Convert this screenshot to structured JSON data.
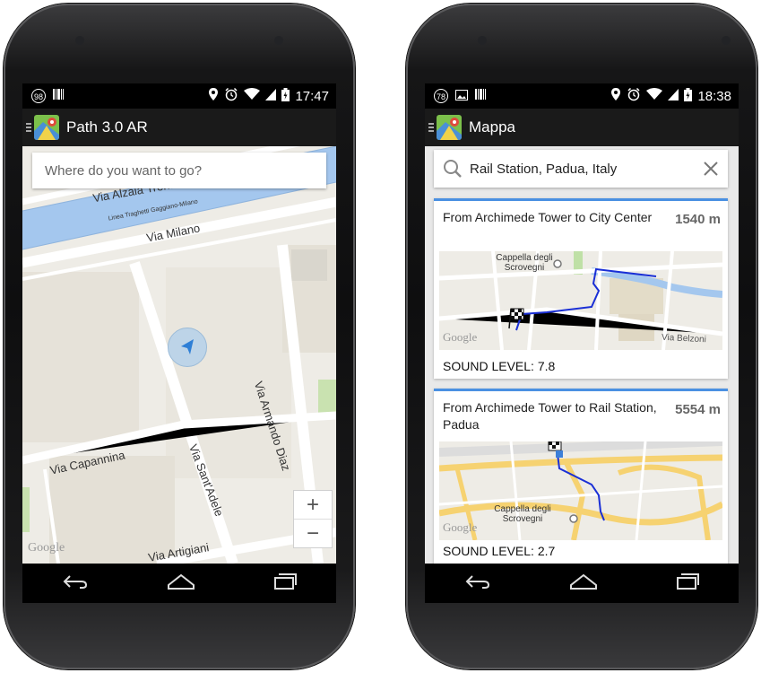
{
  "left_phone": {
    "status": {
      "notification_count": "98",
      "time": "17:47"
    },
    "app_title": "Path 3.0 AR",
    "search": {
      "placeholder": "Where do you want to go?"
    },
    "map_labels": {
      "via_alzaia": "Via Alzaia Trento",
      "linea": "Linea Traghetti Gaggiano-Milano",
      "via_milano": "Via Milano",
      "via_armando_diaz": "Via Armando Diaz",
      "via_capannina": "Via Capannina",
      "via_santadele": "Via Sant'Adele",
      "via_artigiani": "Via Artigiani",
      "google": "Google"
    },
    "zoom": {
      "in": "+",
      "out": "−"
    }
  },
  "right_phone": {
    "status": {
      "notification_count": "78",
      "time": "18:38"
    },
    "app_title": "Mappa",
    "search": {
      "query": "Rail Station, Padua, Italy"
    },
    "routes": [
      {
        "title": "From Archimede Tower to City Center",
        "distance": "1540 m",
        "sound_level": "SOUND LEVEL: 7.8",
        "map_labels": {
          "poi": "Cappella degli Scrovegni",
          "street": "Via Belzoni",
          "google": "Google"
        }
      },
      {
        "title": "From Archimede Tower to Rail Station, Padua",
        "distance": "5554 m",
        "sound_level": "SOUND LEVEL: 2.7",
        "map_labels": {
          "poi": "Cappella degli Scrovegni",
          "google": "Google"
        }
      }
    ]
  },
  "colors": {
    "accent": "#4a90e2",
    "route": "#1a2fd6",
    "water": "#a4c7ee",
    "map_bg": "#f1efe9",
    "highway": "#f6d271"
  }
}
